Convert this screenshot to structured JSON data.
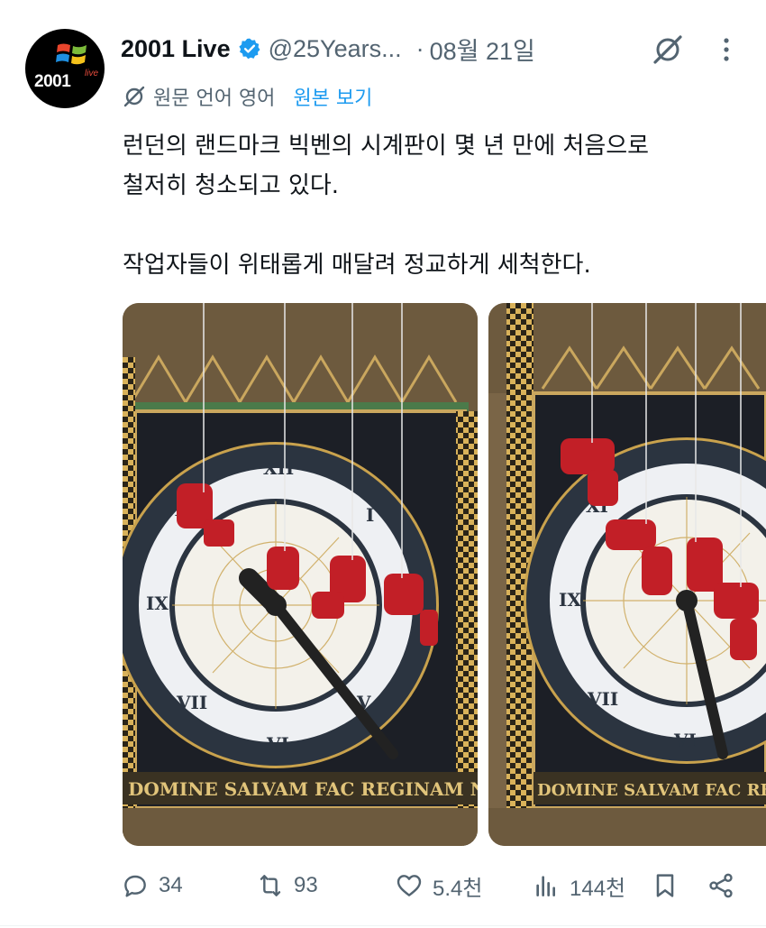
{
  "author": {
    "display_name": "2001 Live",
    "handle": "@25Years...",
    "avatar_text": "2001",
    "avatar_sup": "live"
  },
  "post": {
    "separator": "·",
    "date": "08월 21일",
    "translation": {
      "source_label": "원문 언어 영어",
      "view_original": "원본 보기"
    },
    "text_lines": [
      "런던의 랜드마크 빅벤의 시계판이 몇 년 만에 처음으로",
      "철저히 청소되고 있다.",
      "작업자들이 위태롭게 매달려 정교하게 세척한다."
    ],
    "media": [
      {
        "icon": "clock-face-photo",
        "caption": "DOMINE SALVAM FAC REGINAM NOSTRAM"
      },
      {
        "icon": "clock-face-photo",
        "caption": "DOMINE SALVAM FAC REGINAM"
      }
    ]
  },
  "metrics": {
    "replies": "34",
    "reposts": "93",
    "likes": "5.4천",
    "views": "144천"
  },
  "colors": {
    "text": "#0f1419",
    "secondary": "#536471",
    "accent": "#1d9bf0"
  }
}
